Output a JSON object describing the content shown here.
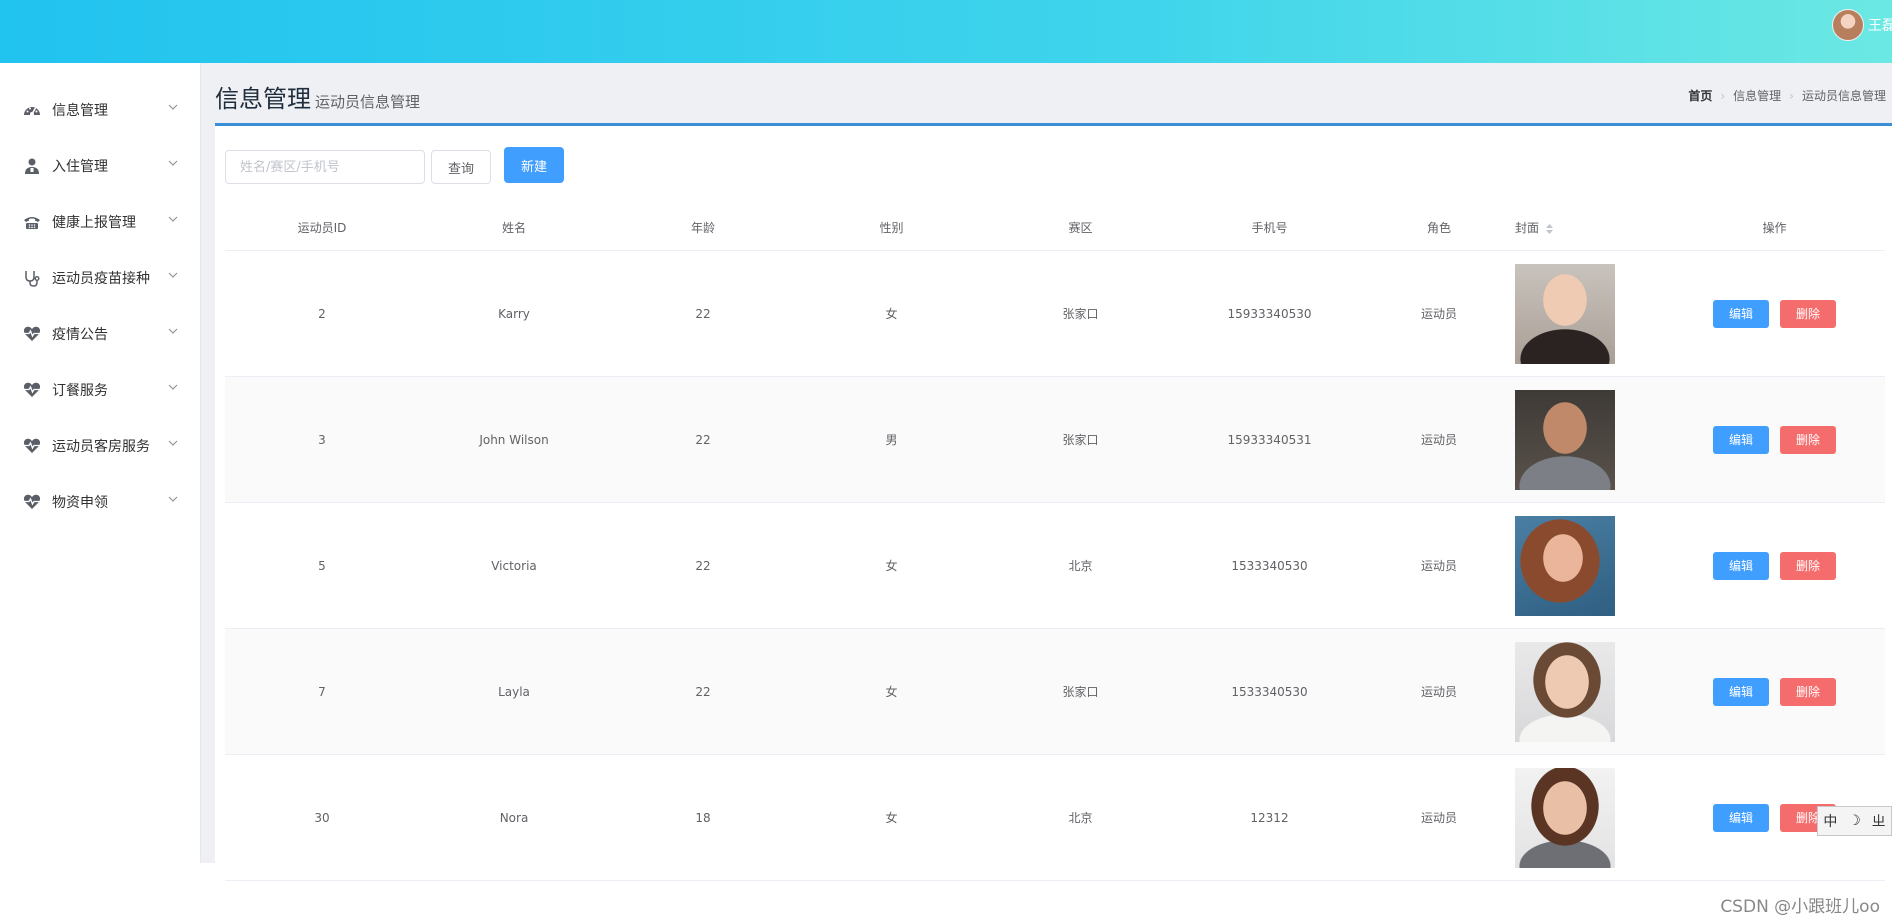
{
  "header": {
    "username": "王磊"
  },
  "sidebar": {
    "items": [
      {
        "label": "信息管理",
        "icon": "dashboard-icon"
      },
      {
        "label": "入住管理",
        "icon": "user-icon"
      },
      {
        "label": "健康上报管理",
        "icon": "phone-icon"
      },
      {
        "label": "运动员疫苗接种",
        "icon": "stethoscope-icon"
      },
      {
        "label": "疫情公告",
        "icon": "heartbeat-icon"
      },
      {
        "label": "订餐服务",
        "icon": "heartbeat-icon"
      },
      {
        "label": "运动员客房服务",
        "icon": "heartbeat-icon"
      },
      {
        "label": "物资申领",
        "icon": "heartbeat-icon"
      }
    ]
  },
  "page": {
    "title": "信息管理",
    "subtitle": "运动员信息管理"
  },
  "breadcrumb": [
    "首页",
    "信息管理",
    "运动员信息管理"
  ],
  "search": {
    "placeholder": "姓名/赛区/手机号",
    "value": "",
    "query_label": "查询",
    "new_label": "新建"
  },
  "table": {
    "headers": [
      "运动员ID",
      "姓名",
      "年龄",
      "性别",
      "赛区",
      "手机号",
      "角色",
      "封面",
      "操作"
    ],
    "rows": [
      {
        "id": "2",
        "name": "Karry",
        "age": "22",
        "gender": "女",
        "zone": "张家口",
        "phone": "15933340530",
        "role": "运动员"
      },
      {
        "id": "3",
        "name": "John Wilson",
        "age": "22",
        "gender": "男",
        "zone": "张家口",
        "phone": "15933340531",
        "role": "运动员"
      },
      {
        "id": "5",
        "name": "Victoria",
        "age": "22",
        "gender": "女",
        "zone": "北京",
        "phone": "1533340530",
        "role": "运动员"
      },
      {
        "id": "7",
        "name": "Layla",
        "age": "22",
        "gender": "女",
        "zone": "张家口",
        "phone": "1533340530",
        "role": "运动员"
      },
      {
        "id": "30",
        "name": "Nora",
        "age": "18",
        "gender": "女",
        "zone": "北京",
        "phone": "12312",
        "role": "运动员"
      }
    ],
    "edit_label": "编辑",
    "delete_label": "删除"
  },
  "ime": {
    "lang": "中",
    "moon": "☽",
    "mode": "ㄓ"
  },
  "watermark": "CSDN @小跟班儿oo",
  "colors": {
    "primary": "#409eff",
    "danger": "#f56c6c",
    "header_start": "#21c3ef",
    "header_end": "#6be8e3",
    "accent_line": "#3b8ed8"
  }
}
